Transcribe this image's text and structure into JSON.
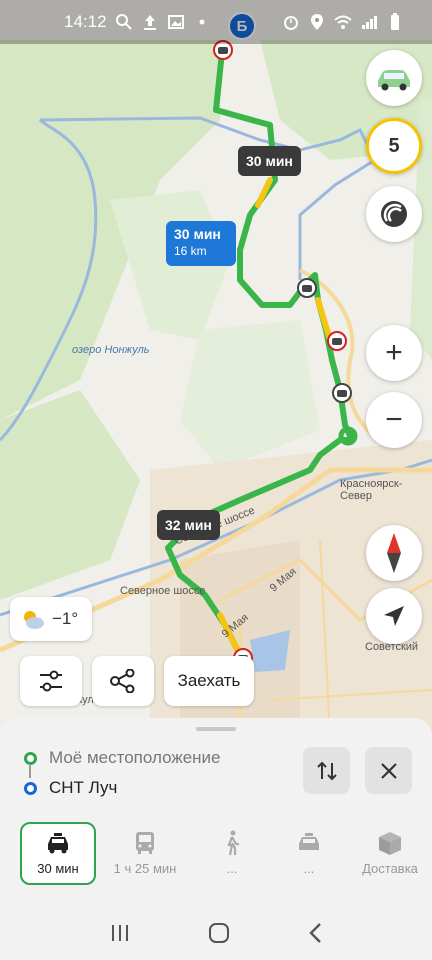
{
  "status_bar": {
    "time": "14:12"
  },
  "map": {
    "destination_marker": "Б",
    "route_badges": [
      {
        "label": "30 мин"
      },
      {
        "label": "32 мин"
      }
    ],
    "selected_route": {
      "time": "30 мин",
      "distance": "16 km"
    },
    "labels": {
      "lake": "озеро Нонжуль",
      "krasnoyarsk": "Красноярск-Север",
      "north_highway_1": "Северное шоссе",
      "north_highway_2": "Северное шоссе",
      "may9_1": "9 Мая",
      "may9_2": "9 Мая",
      "sovetsky": "Советский",
      "vaulny": "раульн"
    },
    "colors": {
      "route_green": "#39b54a",
      "route_yellow": "#f4c515",
      "water": "#9ab8de",
      "green_area": "#cfe4bb"
    }
  },
  "controls": {
    "traffic_level": "5",
    "zoom_in": "+",
    "zoom_out": "−",
    "icons": [
      "car-icon",
      "parking-icon",
      "compass-icon",
      "locate-icon"
    ]
  },
  "weather": {
    "temperature": "−1°",
    "icon": "partly-cloudy-icon"
  },
  "action_chips": {
    "share_icon": "share-icon",
    "filters_icon": "filters-icon",
    "stop_over": "Заехать"
  },
  "route_sheet": {
    "origin": "Моё местоположение",
    "destination": "СНТ Луч",
    "colors": {
      "origin": "#2ea44f",
      "destination": "#1468d6"
    },
    "modes": [
      {
        "label": "30 мин",
        "icon": "taxi-car-icon",
        "active": true
      },
      {
        "label": "1 ч 25 мин",
        "icon": "bus-icon",
        "active": false
      },
      {
        "label": "...",
        "icon": "walk-icon",
        "active": false
      },
      {
        "label": "...",
        "icon": "taxi-icon",
        "active": false
      },
      {
        "label": "Доставка",
        "icon": "delivery-box-icon",
        "active": false
      }
    ]
  }
}
